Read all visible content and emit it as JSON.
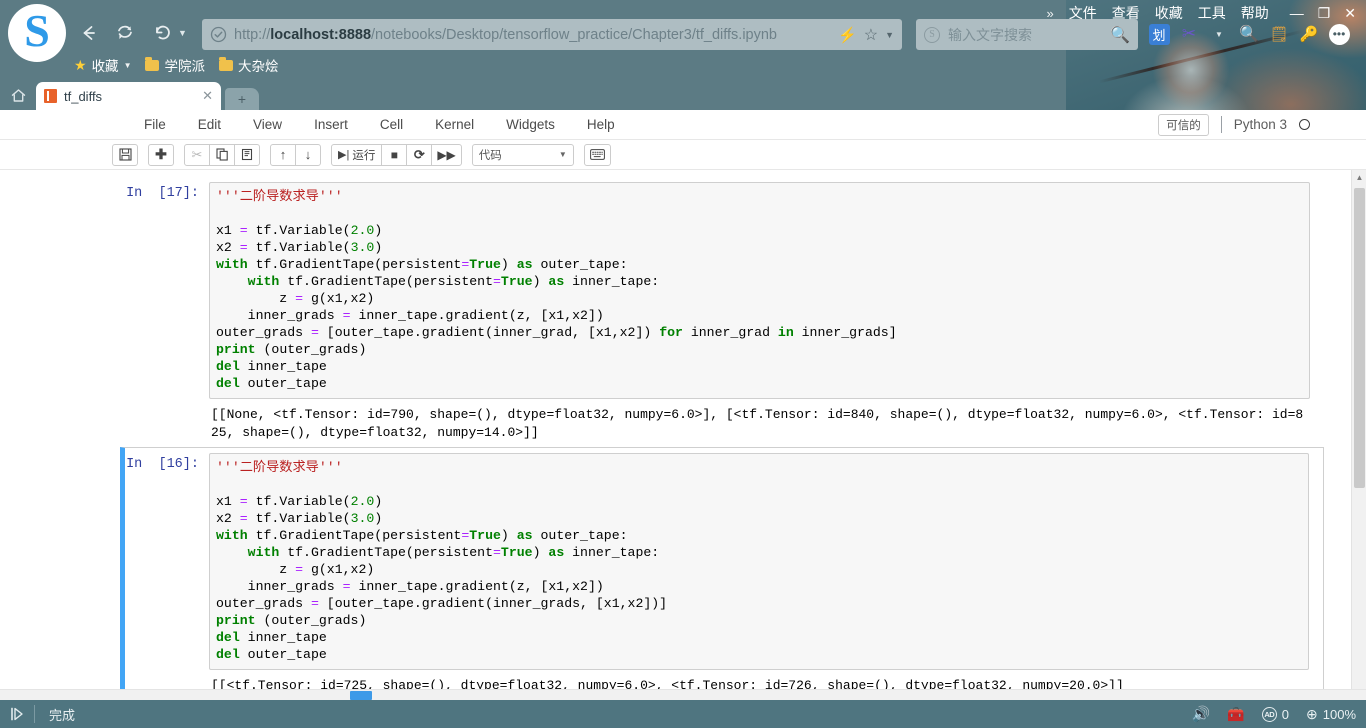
{
  "browser": {
    "logo_letter": "S",
    "nav": {
      "back_icon": "back-arrow-icon",
      "reload_icon": "reload-icon",
      "forward_history_icon": "undo-icon"
    },
    "url": {
      "scheme": "http://",
      "host": "localhost:8888",
      "path": "/notebooks/Desktop/tensorflow_practice/Chapter3/tf_diffs.ipynb",
      "full": "http://localhost:8888/notebooks/Desktop/tensorflow_practice/Chapter3/tf_diffs.ipynb"
    },
    "search": {
      "placeholder": "输入文字搜索"
    },
    "window_menu": [
      "文件",
      "查看",
      "收藏",
      "工具",
      "帮助"
    ],
    "toolbar_badge": "划",
    "bookmarks": [
      {
        "label": "收藏",
        "icon": "star-icon",
        "has_caret": true
      },
      {
        "label": "学院派",
        "icon": "folder-icon",
        "has_caret": false
      },
      {
        "label": "大杂烩",
        "icon": "folder-icon",
        "has_caret": false
      }
    ],
    "tab": {
      "title": "tf_diffs",
      "close_label": "✕",
      "new_tab_label": "+"
    }
  },
  "jupyter": {
    "menu": [
      "File",
      "Edit",
      "View",
      "Insert",
      "Cell",
      "Kernel",
      "Widgets",
      "Help"
    ],
    "trusted_label": "可信的",
    "kernel_name": "Python 3",
    "toolbar": {
      "save_icon": "save-icon",
      "add_icon": "plus-icon",
      "cut_icon": "scissors-icon",
      "copy_icon": "copy-icon",
      "paste_icon": "paste-icon",
      "move_up_icon": "arrow-up-icon",
      "move_down_icon": "arrow-down-icon",
      "run_label": "运行",
      "run_icon": "run-icon",
      "stop_icon": "stop-square-icon",
      "restart_icon": "restart-icon",
      "restart_run_all_icon": "fast-forward-icon",
      "cell_type": "代码",
      "command_palette_icon": "keyboard-icon"
    }
  },
  "cells": [
    {
      "prompt": "In  [17]:",
      "selected": false,
      "code_lines": [
        [
          {
            "t": "'''二阶导数求导'''",
            "c": "k-str"
          }
        ],
        [
          {
            "t": "",
            "c": ""
          }
        ],
        [
          {
            "t": "x1 ",
            "c": ""
          },
          {
            "t": "=",
            "c": "k-op"
          },
          {
            "t": " tf.Variable(",
            "c": ""
          },
          {
            "t": "2.0",
            "c": "k-num"
          },
          {
            "t": ")",
            "c": ""
          }
        ],
        [
          {
            "t": "x2 ",
            "c": ""
          },
          {
            "t": "=",
            "c": "k-op"
          },
          {
            "t": " tf.Variable(",
            "c": ""
          },
          {
            "t": "3.0",
            "c": "k-num"
          },
          {
            "t": ")",
            "c": ""
          }
        ],
        [
          {
            "t": "with",
            "c": "k-kw"
          },
          {
            "t": " tf.GradientTape(persistent",
            "c": ""
          },
          {
            "t": "=",
            "c": "k-op"
          },
          {
            "t": "True",
            "c": "k-true"
          },
          {
            "t": ") ",
            "c": ""
          },
          {
            "t": "as",
            "c": "k-kw"
          },
          {
            "t": " outer_tape:",
            "c": ""
          }
        ],
        [
          {
            "t": "    ",
            "c": ""
          },
          {
            "t": "with",
            "c": "k-kw"
          },
          {
            "t": " tf.GradientTape(persistent",
            "c": ""
          },
          {
            "t": "=",
            "c": "k-op"
          },
          {
            "t": "True",
            "c": "k-true"
          },
          {
            "t": ") ",
            "c": ""
          },
          {
            "t": "as",
            "c": "k-kw"
          },
          {
            "t": " inner_tape:",
            "c": ""
          }
        ],
        [
          {
            "t": "        z ",
            "c": ""
          },
          {
            "t": "=",
            "c": "k-op"
          },
          {
            "t": " g(x1,x2)",
            "c": ""
          }
        ],
        [
          {
            "t": "    inner_grads ",
            "c": ""
          },
          {
            "t": "=",
            "c": "k-op"
          },
          {
            "t": " inner_tape.gradient(z, [x1,x2])",
            "c": ""
          }
        ],
        [
          {
            "t": "outer_grads ",
            "c": ""
          },
          {
            "t": "=",
            "c": "k-op"
          },
          {
            "t": " [outer_tape.gradient(inner_grad, [x1,x2]) ",
            "c": ""
          },
          {
            "t": "for",
            "c": "k-kw"
          },
          {
            "t": " inner_grad ",
            "c": ""
          },
          {
            "t": "in",
            "c": "k-kw"
          },
          {
            "t": " inner_grads]",
            "c": ""
          }
        ],
        [
          {
            "t": "print",
            "c": "k-bi"
          },
          {
            "t": " (outer_grads)",
            "c": ""
          }
        ],
        [
          {
            "t": "del",
            "c": "k-kw"
          },
          {
            "t": " inner_tape",
            "c": ""
          }
        ],
        [
          {
            "t": "del",
            "c": "k-kw"
          },
          {
            "t": " outer_tape",
            "c": ""
          }
        ]
      ],
      "output": "[[None, <tf.Tensor: id=790, shape=(), dtype=float32, numpy=6.0>], [<tf.Tensor: id=840, shape=(), dtype=float32, numpy=6.0>, <tf.Tensor: id=825, shape=(), dtype=float32, numpy=14.0>]]"
    },
    {
      "prompt": "In  [16]:",
      "selected": true,
      "code_lines": [
        [
          {
            "t": "'''二阶导数求导'''",
            "c": "k-str"
          }
        ],
        [
          {
            "t": "",
            "c": ""
          }
        ],
        [
          {
            "t": "x1 ",
            "c": ""
          },
          {
            "t": "=",
            "c": "k-op"
          },
          {
            "t": " tf.Variable(",
            "c": ""
          },
          {
            "t": "2.0",
            "c": "k-num"
          },
          {
            "t": ")",
            "c": ""
          }
        ],
        [
          {
            "t": "x2 ",
            "c": ""
          },
          {
            "t": "=",
            "c": "k-op"
          },
          {
            "t": " tf.Variable(",
            "c": ""
          },
          {
            "t": "3.0",
            "c": "k-num"
          },
          {
            "t": ")",
            "c": ""
          }
        ],
        [
          {
            "t": "with",
            "c": "k-kw"
          },
          {
            "t": " tf.GradientTape(persistent",
            "c": ""
          },
          {
            "t": "=",
            "c": "k-op"
          },
          {
            "t": "True",
            "c": "k-true"
          },
          {
            "t": ") ",
            "c": ""
          },
          {
            "t": "as",
            "c": "k-kw"
          },
          {
            "t": " outer_tape:",
            "c": ""
          }
        ],
        [
          {
            "t": "    ",
            "c": ""
          },
          {
            "t": "with",
            "c": "k-kw"
          },
          {
            "t": " tf.GradientTape(persistent",
            "c": ""
          },
          {
            "t": "=",
            "c": "k-op"
          },
          {
            "t": "True",
            "c": "k-true"
          },
          {
            "t": ") ",
            "c": ""
          },
          {
            "t": "as",
            "c": "k-kw"
          },
          {
            "t": " inner_tape:",
            "c": ""
          }
        ],
        [
          {
            "t": "        z ",
            "c": ""
          },
          {
            "t": "=",
            "c": "k-op"
          },
          {
            "t": " g(x1,x2)",
            "c": ""
          }
        ],
        [
          {
            "t": "    inner_grads ",
            "c": ""
          },
          {
            "t": "=",
            "c": "k-op"
          },
          {
            "t": " inner_tape.gradient(z, [x1,x2])",
            "c": ""
          }
        ],
        [
          {
            "t": "outer_grads ",
            "c": ""
          },
          {
            "t": "=",
            "c": "k-op"
          },
          {
            "t": " [outer_tape.gradient(inner_grads, [x1,x2])]",
            "c": ""
          }
        ],
        [
          {
            "t": "print",
            "c": "k-bi"
          },
          {
            "t": " (outer_grads)",
            "c": ""
          }
        ],
        [
          {
            "t": "del",
            "c": "k-kw"
          },
          {
            "t": " inner_tape",
            "c": ""
          }
        ],
        [
          {
            "t": "del",
            "c": "k-kw"
          },
          {
            "t": " outer_tape",
            "c": ""
          }
        ]
      ],
      "output": "[[<tf.Tensor: id=725, shape=(), dtype=float32, numpy=6.0>, <tf.Tensor: id=726, shape=(), dtype=float32, numpy=20.0>]]"
    }
  ],
  "statusbar": {
    "left_icon": "play-pause-icon",
    "text": "完成",
    "volume_icon": "speaker-icon",
    "toolbox_icon": "toolbox-icon",
    "ad_blocked_label": "AD",
    "ad_blocked_count": "0",
    "zoom_level": "100%"
  },
  "colors": {
    "chrome_bg": "#5c7b84",
    "accent_blue": "#42a5f5",
    "statusbar_bg": "#4f7580",
    "string_red": "#ba2121",
    "keyword_green": "#008000",
    "operator_purple": "#aa22ff",
    "prompt_blue": "#303f9f"
  }
}
